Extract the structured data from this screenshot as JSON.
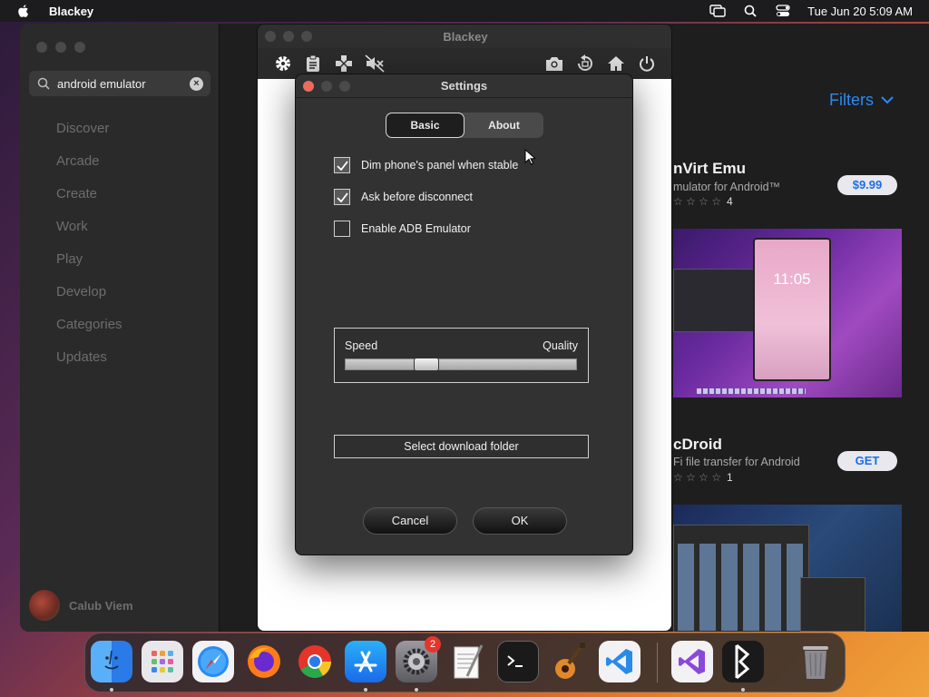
{
  "menubar": {
    "app_name": "Blackey",
    "datetime": "Tue Jun 20  5:09 AM"
  },
  "appstore": {
    "search_value": "android emulator",
    "nav": [
      "Discover",
      "Arcade",
      "Create",
      "Work",
      "Play",
      "Develop",
      "Categories",
      "Updates"
    ],
    "user_name": "Calub Viem",
    "filters_label": "Filters",
    "results": [
      {
        "title": "nVirt Emu",
        "subtitle": "mulator for Android™",
        "rating_count": "4",
        "price": "$9.99",
        "screenshot_clock": "11:05"
      },
      {
        "title": "cDroid",
        "subtitle": "Fi file transfer for Android",
        "rating_count": "1",
        "price": "GET"
      }
    ]
  },
  "blackey": {
    "title": "Blackey",
    "toolbar": [
      "gear-icon",
      "clipboard-icon",
      "gamepad-icon",
      "speaker-muted-icon",
      "camera-icon",
      "rotate-icon",
      "home-icon",
      "power-icon"
    ]
  },
  "settings": {
    "title": "Settings",
    "tabs": [
      {
        "label": "Basic",
        "active": true
      },
      {
        "label": "About",
        "active": false
      }
    ],
    "options": [
      {
        "label": "Dim phone's panel when stable",
        "checked": true
      },
      {
        "label": "Ask before disconnect",
        "checked": true
      },
      {
        "label": "Enable ADB Emulator",
        "checked": false
      }
    ],
    "slider": {
      "left_label": "Speed",
      "right_label": "Quality",
      "value": 0.35
    },
    "folder_button": "Select download folder",
    "cancel_label": "Cancel",
    "ok_label": "OK"
  },
  "dock": {
    "items": [
      "finder",
      "launchpad",
      "safari",
      "firefox",
      "chrome",
      "app-store",
      "system-settings",
      "textedit",
      "terminal",
      "garageband",
      "vscode",
      "visual-studio",
      "blackey",
      "trash"
    ],
    "system_settings_badge": "2"
  },
  "colors": {
    "accent_blue": "#2a8af6",
    "close_red": "#ed6a5e",
    "dock_badge": "#e5352b"
  }
}
